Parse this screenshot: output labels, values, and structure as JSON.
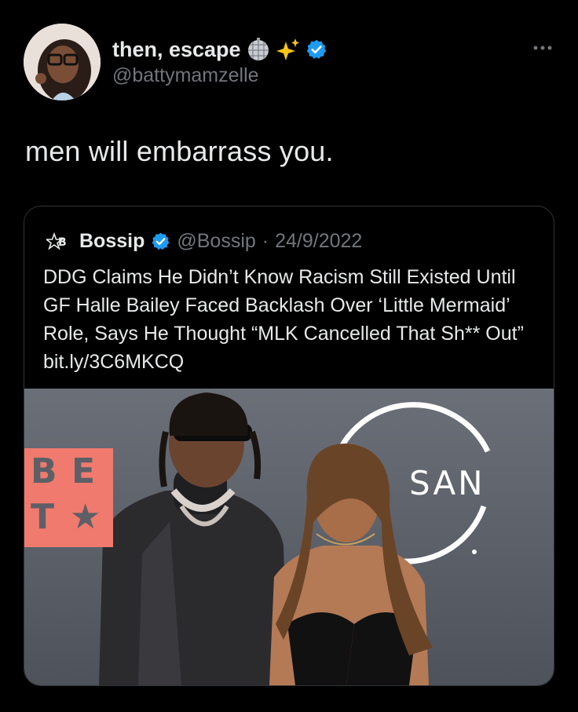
{
  "tweet": {
    "display_name": "then, escape",
    "name_emojis": [
      "disco-ball-icon",
      "sparkles-icon"
    ],
    "handle": "@battymamzelle",
    "text": "men will embarrass you."
  },
  "quote": {
    "name": "Bossip",
    "handle": "@Bossip",
    "separator": "·",
    "date": "24/9/2022",
    "text": "DDG Claims He Didn’t Know Racism Still Existed Until GF Halle Bailey Faced Backlash Over ‘Little Mermaid’ Role, Says He Thought “MLK Cancelled That Sh** Out” bit.ly/3C6MKCQ",
    "media": {
      "backdrop_logo_left": [
        "B",
        "E",
        "T",
        "★"
      ],
      "backdrop_logo_right": "SAN"
    }
  },
  "colors": {
    "background": "#000000",
    "text_primary": "#e7e9ea",
    "text_secondary": "#71767b",
    "verified": "#1d9bf0",
    "card_border": "#2f3336",
    "bet_logo": "#f07a6e"
  }
}
